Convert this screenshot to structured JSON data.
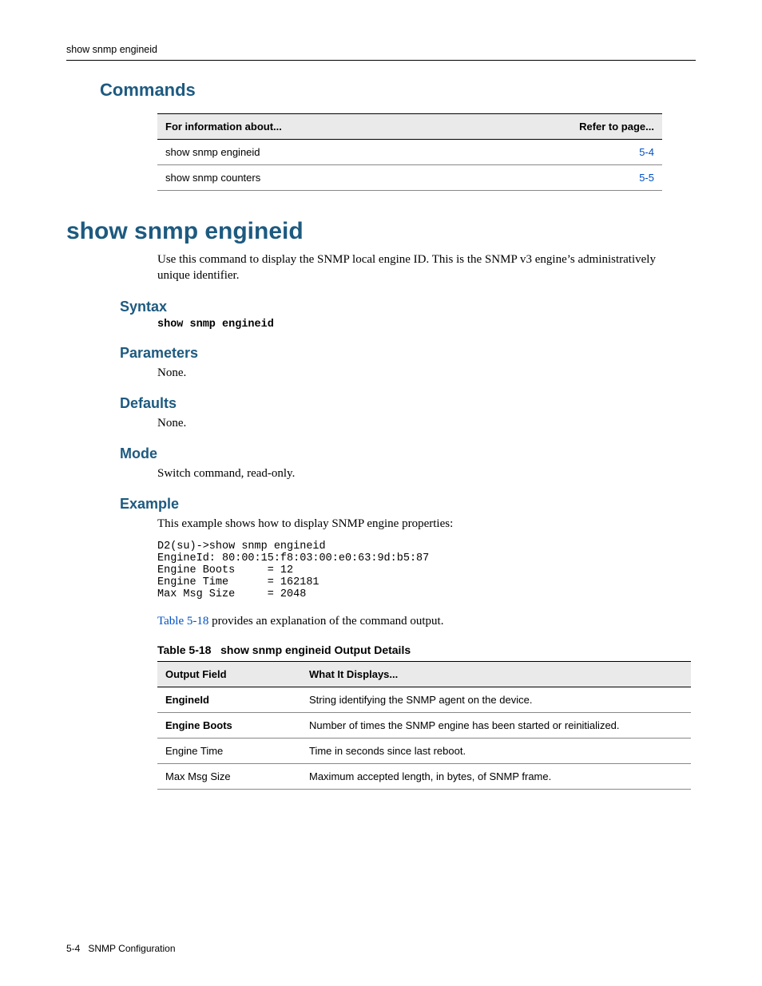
{
  "running_head": "show snmp engineid",
  "commands": {
    "heading": "Commands",
    "hdr_info": "For information about...",
    "hdr_page": "Refer to page...",
    "rows": [
      {
        "cmd": "show snmp engineid",
        "page": "5-4"
      },
      {
        "cmd": "show snmp counters",
        "page": "5-5"
      }
    ]
  },
  "title": "show snmp engineid",
  "intro": "Use this command to display the SNMP local engine ID. This is the SNMP v3 engine’s administratively unique identifier.",
  "syntax": {
    "heading": "Syntax",
    "code": "show snmp engineid"
  },
  "parameters": {
    "heading": "Parameters",
    "text": "None."
  },
  "defaults": {
    "heading": "Defaults",
    "text": "None."
  },
  "mode": {
    "heading": "Mode",
    "text": "Switch command, read-only."
  },
  "example": {
    "heading": "Example",
    "lead": "This example shows how to display SNMP engine properties:",
    "code": "D2(su)->show snmp engineid\nEngineId: 80:00:15:f8:03:00:e0:63:9d:b5:87\nEngine Boots     = 12\nEngine Time      = 162181\nMax Msg Size     = 2048",
    "xref_link": "Table 5-18",
    "xref_tail": " provides an explanation of the command output."
  },
  "table518": {
    "caption_num": "Table 5-18",
    "caption_title": "show snmp engineid Output Details",
    "hdr_field": "Output Field",
    "hdr_disp": "What It Displays...",
    "rows": [
      {
        "field": "EngineId",
        "bold": true,
        "disp": "String identifying the SNMP agent on the device."
      },
      {
        "field": "Engine Boots",
        "bold": true,
        "disp": "Number of times the SNMP engine has been started or reinitialized."
      },
      {
        "field": "Engine Time",
        "bold": false,
        "disp": "Time in seconds since last reboot."
      },
      {
        "field": "Max Msg Size",
        "bold": false,
        "disp": "Maximum accepted length, in bytes, of SNMP frame."
      }
    ]
  },
  "footer": {
    "pagenum": "5-4",
    "section": "SNMP Configuration"
  }
}
